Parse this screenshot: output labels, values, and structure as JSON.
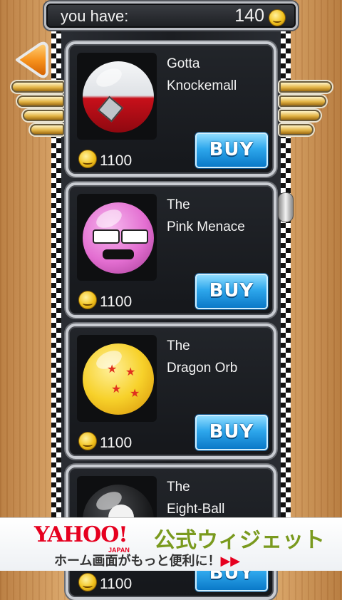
{
  "header": {
    "label": "you have:",
    "coin_count": "140",
    "coin_icon": "coin-icon"
  },
  "navigation": {
    "back_icon": "back-arrow-icon"
  },
  "shop": {
    "items": [
      {
        "name_line1": "Gotta",
        "name_line2": "Knockemall",
        "price": "1100",
        "buy_label": "BUY",
        "ball_colors": [
          "#eef0f2",
          "#c8101a"
        ]
      },
      {
        "name_line1": "The",
        "name_line2": "Pink Menace",
        "price": "1100",
        "buy_label": "BUY",
        "ball_colors": [
          "#e36ed1",
          "#f6b7ee"
        ]
      },
      {
        "name_line1": "The",
        "name_line2": "Dragon Orb",
        "price": "1100",
        "buy_label": "BUY",
        "ball_colors": [
          "#f7d12a",
          "#e39a0a"
        ]
      },
      {
        "name_line1": "The",
        "name_line2": "Eight-Ball",
        "price": "1100",
        "buy_label": "BUY",
        "ball_colors": [
          "#2a2b2e",
          "#0a0a0b"
        ]
      }
    ]
  },
  "ad": {
    "brand": "YAHOO!",
    "brand_sub": "JAPAN",
    "headline": "公式ウィジェット",
    "subline": "ホーム画面がもっと便利に！",
    "arrows": "▶▶",
    "colors": {
      "brand": "#e6001f",
      "headline": "#7a9a1e"
    }
  }
}
